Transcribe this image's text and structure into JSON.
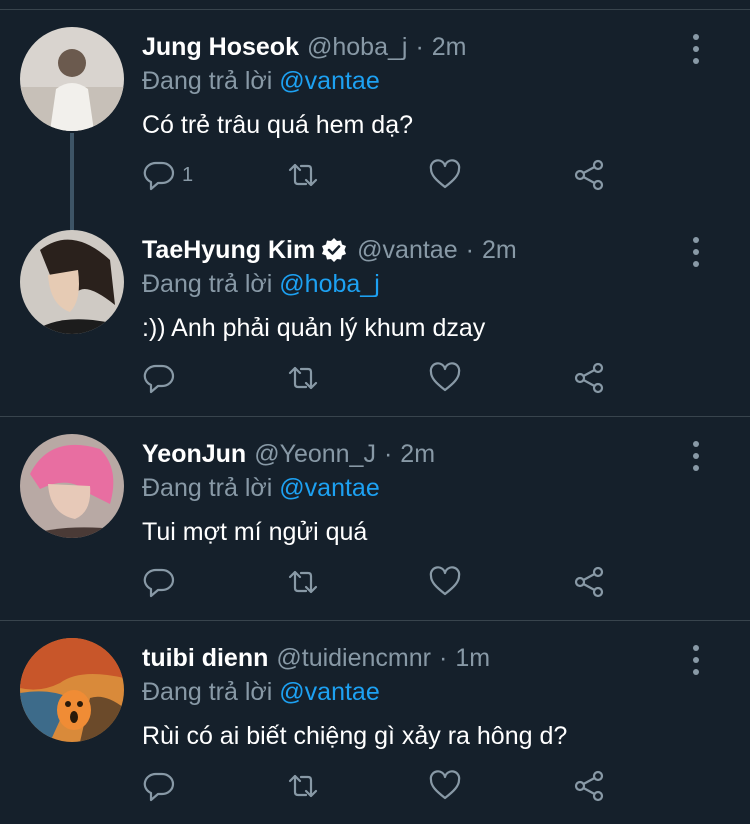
{
  "colors": {
    "background": "#15202b",
    "muted": "#8899a6",
    "accent": "#1da1f2",
    "divider": "#38444d"
  },
  "tweets": [
    {
      "name": "Jung Hoseok",
      "verified": false,
      "handle": "@hoba_j",
      "dot": "·",
      "time": "2m",
      "replying_prefix": "Đang trả lời",
      "replying_to": "@vantae",
      "text": "Có trẻ trâu quá hem dạ?",
      "reply_count": "1"
    },
    {
      "name": "TaeHyung Kim",
      "verified": true,
      "handle": "@vantae",
      "dot": "·",
      "time": "2m",
      "replying_prefix": "Đang trả lời",
      "replying_to": "@hoba_j",
      "text": ":)) Anh phải quản lý khum dzay",
      "reply_count": ""
    },
    {
      "name": "YeonJun",
      "verified": false,
      "handle": "@Yeonn_J",
      "dot": "·",
      "time": "2m",
      "replying_prefix": "Đang trả lời",
      "replying_to": "@vantae",
      "text": "Tui mợt mí ngửi quá",
      "reply_count": ""
    },
    {
      "name": "tuibi dienn",
      "verified": false,
      "handle": "@tuidiencmnr",
      "dot": "·",
      "time": "1m",
      "replying_prefix": "Đang trả lời",
      "replying_to": "@vantae",
      "text": "Rùi có ai biết chiệng gì xảy ra hông d?",
      "reply_count": ""
    }
  ],
  "icons": {
    "reply": "reply-icon",
    "retweet": "retweet-icon",
    "like": "heart-icon",
    "share": "share-icon",
    "more": "more-vertical-icon",
    "verified": "verified-badge-icon"
  }
}
